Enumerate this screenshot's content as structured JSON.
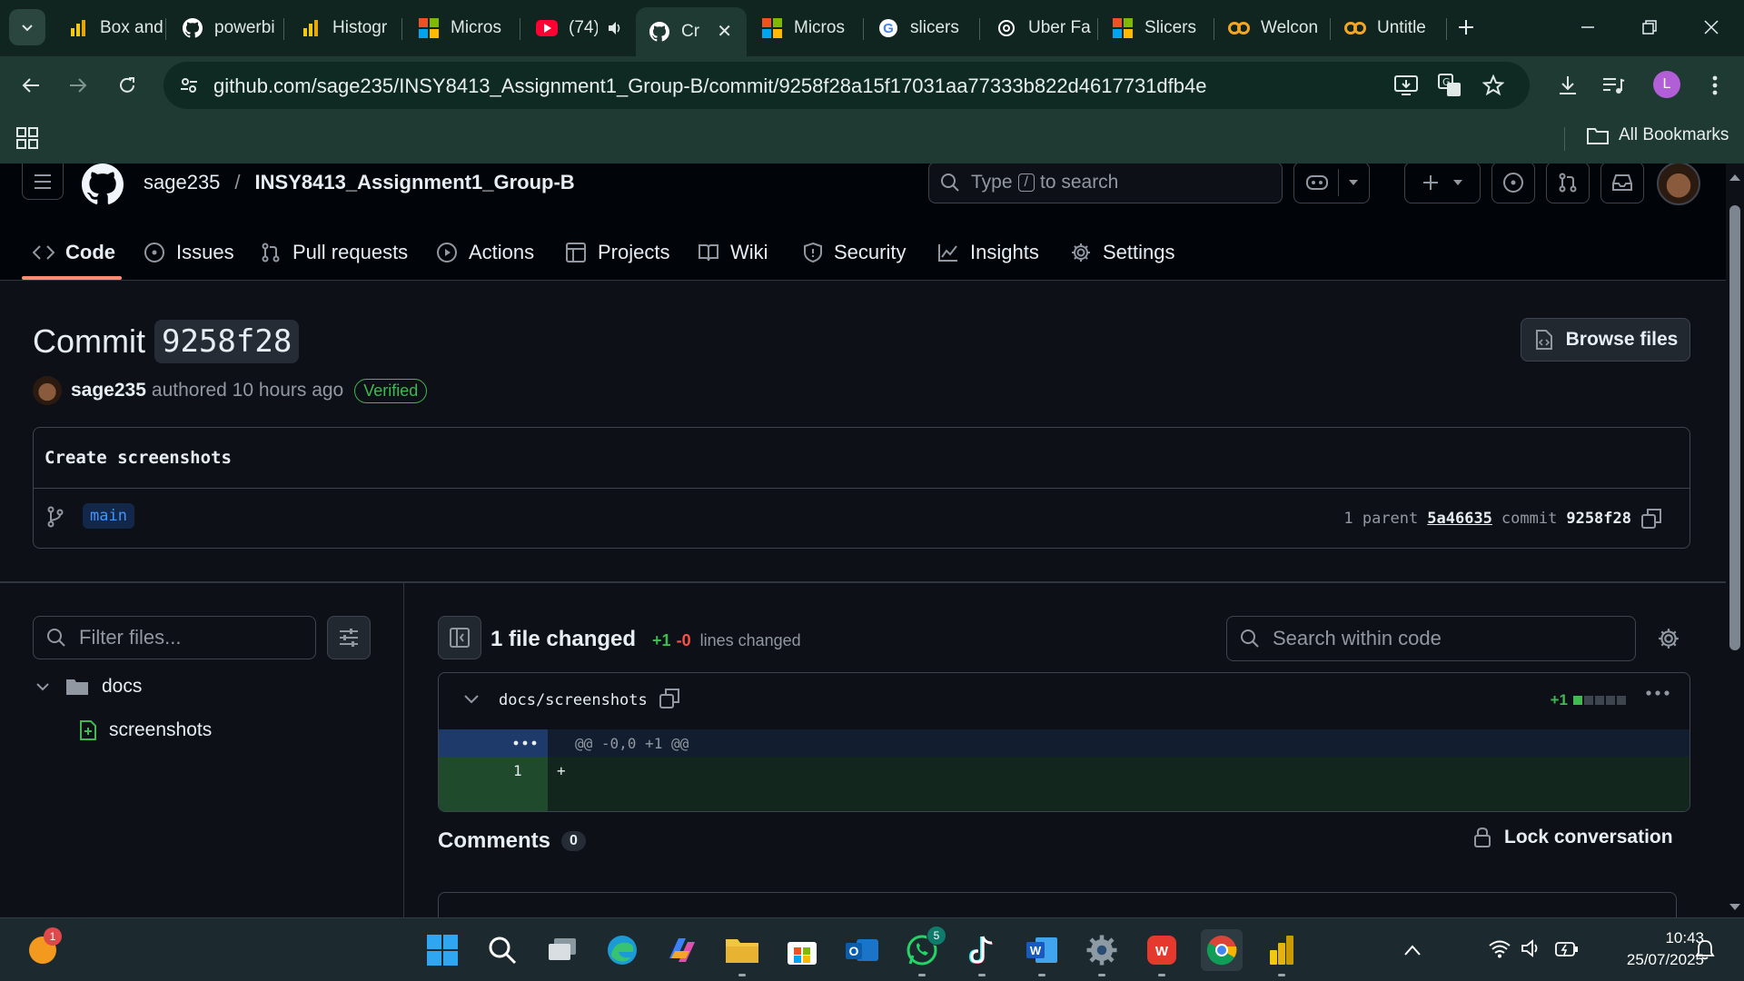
{
  "browser": {
    "tabs": [
      {
        "label": "Box and",
        "icon": "powerbi-icon"
      },
      {
        "label": "powerbi",
        "icon": "github-icon"
      },
      {
        "label": "Histogr",
        "icon": "powerbi-icon"
      },
      {
        "label": "Micros",
        "icon": "microsoft-icon"
      },
      {
        "label": "(74)",
        "icon": "youtube-icon"
      },
      {
        "label": "Cr",
        "icon": "github-icon",
        "active": true
      },
      {
        "label": "Micros",
        "icon": "microsoft-icon"
      },
      {
        "label": "slicers",
        "icon": "google-icon"
      },
      {
        "label": "Uber Fa",
        "icon": "openai-icon"
      },
      {
        "label": "Slicers",
        "icon": "microsoft-icon"
      },
      {
        "label": "Welcon",
        "icon": "coursera-icon"
      },
      {
        "label": "Untitle",
        "icon": "coursera-icon"
      }
    ],
    "url": "github.com/sage235/INSY8413_Assignment1_Group-B/commit/9258f28a15f17031aa77333b822d4617731dfb4e",
    "profile_initial": "L",
    "bookmarks_label": "All Bookmarks"
  },
  "header": {
    "owner": "sage235",
    "separator": "/",
    "repo": "INSY8413_Assignment1_Group-B",
    "search_prefix": "Type",
    "search_key": "/",
    "search_suffix": "to search"
  },
  "repo_nav": [
    {
      "label": "Code",
      "icon": "code-icon"
    },
    {
      "label": "Issues",
      "icon": "issue-icon"
    },
    {
      "label": "Pull requests",
      "icon": "pull-request-icon"
    },
    {
      "label": "Actions",
      "icon": "play-icon"
    },
    {
      "label": "Projects",
      "icon": "table-icon"
    },
    {
      "label": "Wiki",
      "icon": "book-icon"
    },
    {
      "label": "Security",
      "icon": "shield-icon"
    },
    {
      "label": "Insights",
      "icon": "graph-icon"
    },
    {
      "label": "Settings",
      "icon": "gear-icon"
    }
  ],
  "commit": {
    "title_prefix": "Commit",
    "short_sha": "9258f28",
    "browse_files": "Browse files",
    "author": "sage235",
    "authored_text": "authored 10 hours ago",
    "verified": "Verified",
    "message": "Create screenshots",
    "branch": "main",
    "parent_label": "1 parent",
    "parent_sha": "5a46635",
    "commit_label": "commit",
    "commit_sha": "9258f28"
  },
  "files": {
    "filter_placeholder": "Filter files...",
    "tree": {
      "folder": "docs",
      "file": "screenshots"
    }
  },
  "diff": {
    "summary": "1 file changed",
    "additions": "+1",
    "deletions": "-0",
    "lines_changed": "lines changed",
    "search_placeholder": "Search within code",
    "file_path": "docs/screenshots",
    "file_additions": "+1",
    "hunk_header": "@@ -0,0 +1 @@",
    "line_number": "1",
    "line_content": "+"
  },
  "comments": {
    "heading": "Comments",
    "count": "0",
    "lock_label": "Lock conversation"
  },
  "taskbar": {
    "notification_badge": "1",
    "whatsapp_badge": "5",
    "time": "10:43",
    "date": "25/07/2025"
  },
  "colors": {
    "accent_underline": "#fd8c73",
    "verified_green": "#3fb950",
    "deletion_red": "#f85149",
    "link_blue": "#4493f8"
  }
}
